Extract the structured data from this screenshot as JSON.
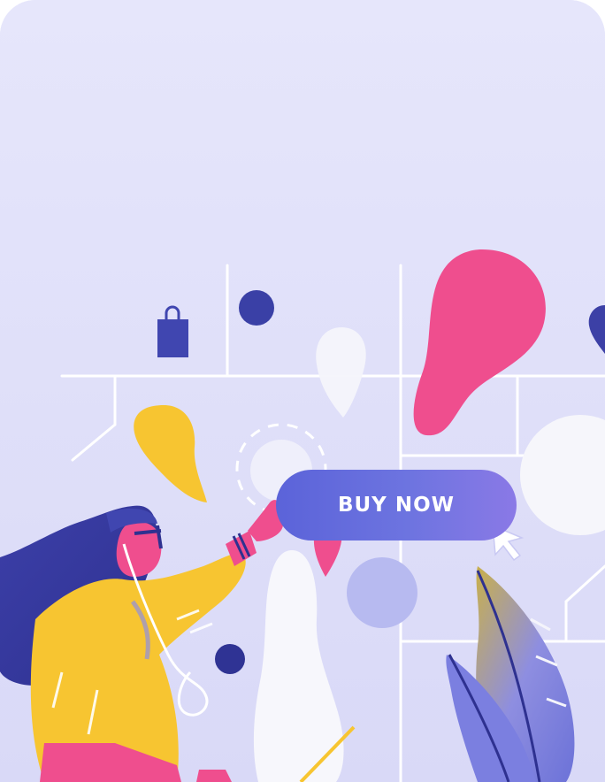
{
  "illustration": {
    "button_label": "BUY NOW",
    "icons": [
      "shopping-bag-icon",
      "cursor-arrow-icon"
    ],
    "colors": {
      "background": "#e3e3fb",
      "grid_lines": "#ffffff",
      "navy": "#3c40a6",
      "indigo": "#5b63d9",
      "pink": "#ef4e8e",
      "yellow": "#f7c531",
      "white_shape": "#f4f4fb",
      "light_blue": "#b7baf0"
    }
  }
}
